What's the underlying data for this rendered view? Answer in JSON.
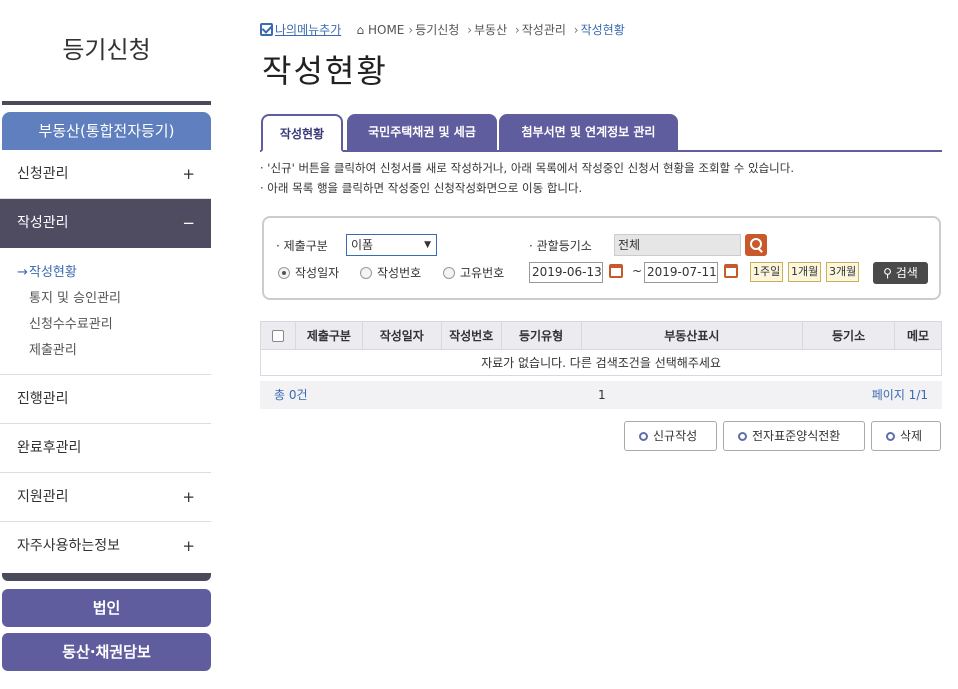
{
  "sidebar": {
    "title": "등기신청",
    "category": "부동산(통합전자등기)",
    "items": [
      {
        "label": "신청관리",
        "sign": "+"
      },
      {
        "label": "작성관리",
        "sign": "−"
      },
      {
        "label": "진행관리",
        "sign": ""
      },
      {
        "label": "완료후관리",
        "sign": ""
      },
      {
        "label": "지원관리",
        "sign": "+"
      },
      {
        "label": "자주사용하는정보",
        "sign": "+"
      }
    ],
    "subitems": [
      "작성현황",
      "통지 및 승인관리",
      "신청수수료관리",
      "제출관리"
    ],
    "bottom_buttons": [
      "법인",
      "동산·채권담보"
    ]
  },
  "breadcrumb": {
    "mymenu": "나의메뉴추가",
    "home": "HOME",
    "path": [
      "등기신청",
      "부동산",
      "작성관리",
      "작성현황"
    ]
  },
  "page_title": "작성현황",
  "tabs": [
    "작성현황",
    "국민주택채권 및 세금",
    "첨부서면 및 연계정보 관리"
  ],
  "notes": [
    "· '신규' 버튼을 클릭하여 신청서를 새로 작성하거나, 아래 목록에서 작성중인 신청서 현황을 조회할 수 있습니다.",
    "· 아래 목록 행을 클릭하면 작성중인 신청작성화면으로 이동 합니다."
  ],
  "search": {
    "submit_type_label": "제출구분",
    "submit_type_value": "이폼",
    "office_label": "관할등기소",
    "office_value": "전체",
    "radios": [
      {
        "label": "작성일자",
        "selected": true
      },
      {
        "label": "작성번호",
        "selected": false
      },
      {
        "label": "고유번호",
        "selected": false
      }
    ],
    "date_from": "2019-06-13",
    "date_to": "2019-07-11",
    "tilde": "~",
    "periods": [
      "1주일",
      "1개월",
      "3개월"
    ],
    "search_button": "검색"
  },
  "table": {
    "columns": [
      "제출구분",
      "작성일자",
      "작성번호",
      "등기유형",
      "부동산표시",
      "등기소",
      "메모"
    ],
    "empty_message": "자료가 없습니다. 다른 검색조건을 선택해주세요"
  },
  "pager": {
    "total": "총 0건",
    "page_number": "1",
    "pages": "페이지 1/1"
  },
  "actions": [
    "신규작성",
    "전자표준양식전환",
    "삭제"
  ],
  "colors": {
    "accent": "#5f5d9e",
    "category": "#5f7fbf",
    "active_menu": "#4f4c61",
    "search_icon": "#c9582a"
  }
}
